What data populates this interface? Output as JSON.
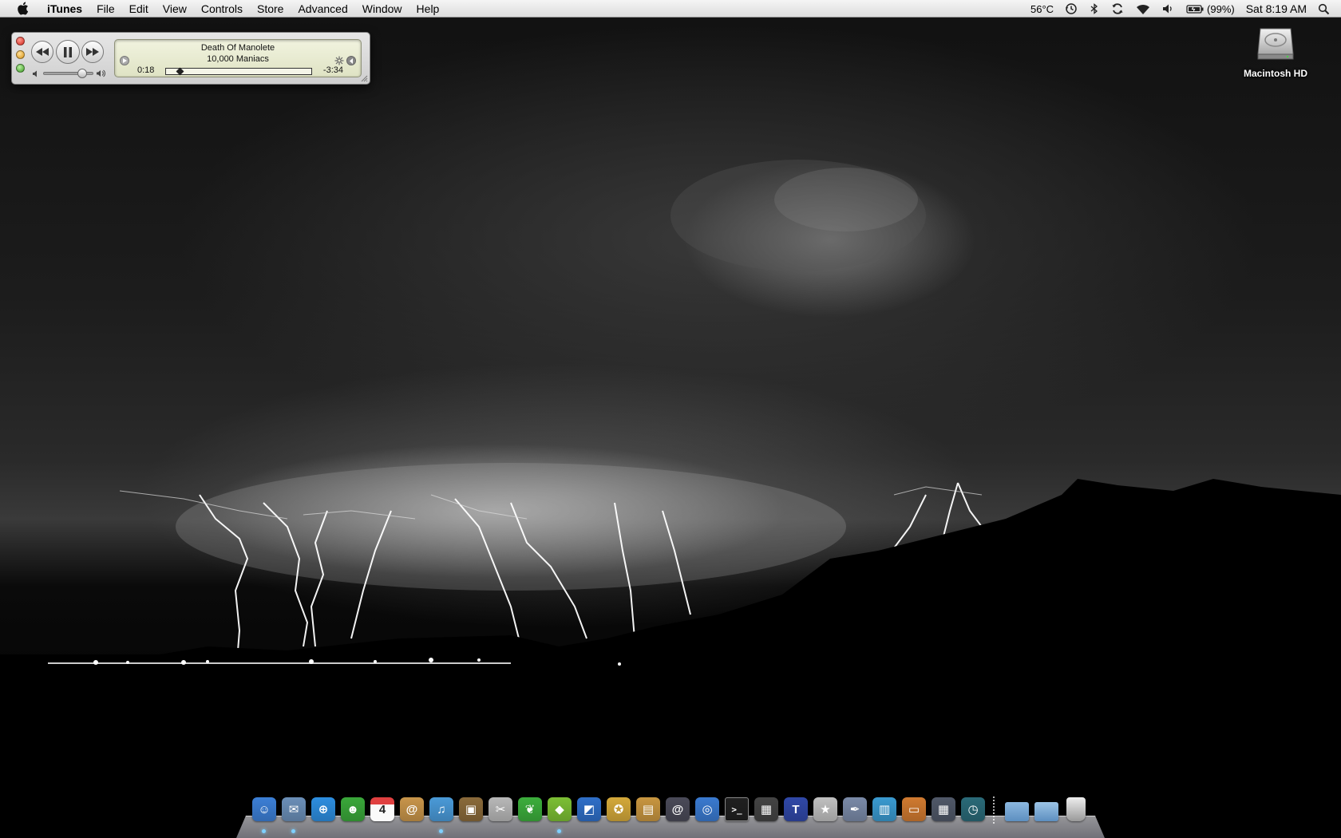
{
  "menubar": {
    "apple_icon": "apple-logo",
    "app_name": "iTunes",
    "menus": [
      "File",
      "Edit",
      "View",
      "Controls",
      "Store",
      "Advanced",
      "Window",
      "Help"
    ],
    "extras": {
      "temperature": "56°C",
      "time_machine_icon": "clock-history-icon",
      "bluetooth_icon": "bluetooth-icon",
      "sync_icon": "sync-icon",
      "wifi_icon": "wifi-icon",
      "volume_icon": "speaker-icon",
      "battery_icon": "battery-icon",
      "battery_percent": "(99%)",
      "clock": "Sat 8:19 AM",
      "spotlight_icon": "spotlight-icon"
    }
  },
  "mini_player": {
    "song": "Death Of Manolete",
    "artist": "10,000 Maniacs",
    "elapsed": "0:18",
    "remaining": "-3:34",
    "progress_fraction": 0.08,
    "volume_fraction": 0.8,
    "state": "playing"
  },
  "desktop": {
    "drive_label": "Macintosh HD"
  },
  "dock": {
    "apps": [
      {
        "name": "Finder",
        "icon": "finder-icon",
        "glyph": "☺",
        "color": "#3c7fd6",
        "running": true
      },
      {
        "name": "Mail",
        "icon": "mail-icon",
        "glyph": "✉",
        "color": "#6b8fb8",
        "running": true
      },
      {
        "name": "Safari",
        "icon": "safari-icon",
        "glyph": "⊕",
        "color": "#2d8ee0",
        "running": false
      },
      {
        "name": "iChat",
        "icon": "ichat-icon",
        "glyph": "☻",
        "color": "#3aa83a",
        "running": false
      },
      {
        "name": "iCal",
        "icon": "ical-icon",
        "glyph": "4",
        "color": "#d8d8d8",
        "running": false
      },
      {
        "name": "Address Book",
        "icon": "address-book-icon",
        "glyph": "@",
        "color": "#c8954a",
        "running": false
      },
      {
        "name": "iTunes",
        "icon": "itunes-icon",
        "glyph": "♫",
        "color": "#4a9ad8",
        "running": true
      },
      {
        "name": "iPhoto",
        "icon": "iphoto-icon",
        "glyph": "▣",
        "color": "#8a6a3a",
        "running": false
      },
      {
        "name": "Preview",
        "icon": "preview-icon",
        "glyph": "✂",
        "color": "#b8b8b8",
        "running": false
      },
      {
        "name": "Leaf",
        "icon": "leaf-icon",
        "glyph": "❦",
        "color": "#3cae3c",
        "running": false
      },
      {
        "name": "Syncing",
        "icon": "sync-app-icon",
        "glyph": "◆",
        "color": "#7cbf34",
        "running": true
      },
      {
        "name": "Xcode",
        "icon": "blueprint-icon",
        "glyph": "◩",
        "color": "#2f6fc8",
        "running": false
      },
      {
        "name": "Adium",
        "icon": "adium-icon",
        "glyph": "✪",
        "color": "#d4a93a",
        "running": false
      },
      {
        "name": "Pages",
        "icon": "pages-icon",
        "glyph": "▤",
        "color": "#c89640",
        "running": false
      },
      {
        "name": "Camino",
        "icon": "camino-icon",
        "glyph": "@",
        "color": "#4a4a58",
        "running": false
      },
      {
        "name": "DVD Player",
        "icon": "dvd-icon",
        "glyph": "◎",
        "color": "#3a7ad0",
        "running": false
      },
      {
        "name": "Terminal",
        "icon": "terminal-icon",
        "glyph": ">_",
        "color": "#202020",
        "running": false
      },
      {
        "name": "Final Cut",
        "icon": "clapper-icon",
        "glyph": "▦",
        "color": "#444",
        "running": false
      },
      {
        "name": "iMovie",
        "icon": "imovie-icon",
        "glyph": "T",
        "color": "#3048a8",
        "running": false
      },
      {
        "name": "iMovie Star",
        "icon": "star-icon",
        "glyph": "★",
        "color": "#c0c0c0",
        "running": false
      },
      {
        "name": "Quill",
        "icon": "quill-icon",
        "glyph": "✒",
        "color": "#7a8aa8",
        "running": false
      },
      {
        "name": "Numbers",
        "icon": "numbers-icon",
        "glyph": "▥",
        "color": "#3a9ad0",
        "running": false
      },
      {
        "name": "Keynote",
        "icon": "keynote-icon",
        "glyph": "▭",
        "color": "#d07a30",
        "running": false
      },
      {
        "name": "Dashboard",
        "icon": "dashboard-icon",
        "glyph": "▦",
        "color": "#505868",
        "running": false
      },
      {
        "name": "Time Machine",
        "icon": "time-machine-icon",
        "glyph": "◷",
        "color": "#2a6a78",
        "running": false
      }
    ],
    "stacks": [
      {
        "name": "Applications",
        "icon": "folder-icon",
        "color": "#8cb8e0"
      },
      {
        "name": "Documents",
        "icon": "folder-stack-icon",
        "color": "#9cc4e6"
      },
      {
        "name": "Trash",
        "icon": "trash-icon",
        "color": "#c8c8c8"
      }
    ]
  }
}
